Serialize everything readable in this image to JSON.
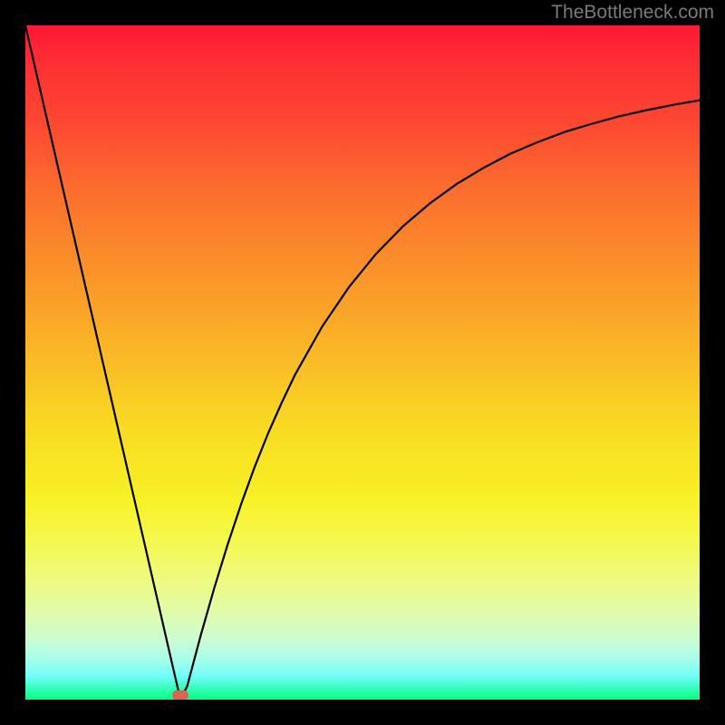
{
  "watermark": "TheBottleneck.com",
  "colors": {
    "curve_stroke": "#000000",
    "min_point": "#d9674f"
  },
  "chart_data": {
    "type": "line",
    "title": "",
    "xlabel": "",
    "ylabel": "",
    "xlim": [
      0,
      100
    ],
    "ylim": [
      0,
      100
    ],
    "x": [
      0,
      2,
      4,
      6,
      8,
      10,
      12,
      14,
      16,
      18,
      20,
      22,
      23,
      24,
      26,
      28,
      30,
      32,
      34,
      36,
      38,
      40,
      44,
      48,
      52,
      56,
      60,
      64,
      68,
      72,
      76,
      80,
      84,
      88,
      92,
      96,
      100
    ],
    "y": [
      100,
      91.3,
      82.6,
      73.9,
      65.2,
      56.5,
      47.8,
      39.1,
      30.4,
      21.7,
      13.0,
      4.3,
      0.0,
      2.0,
      9.5,
      16.5,
      23.0,
      29.0,
      34.5,
      39.5,
      44.0,
      48.2,
      55.3,
      61.2,
      66.1,
      70.2,
      73.6,
      76.5,
      78.9,
      81.0,
      82.7,
      84.2,
      85.4,
      86.5,
      87.4,
      88.2,
      88.9
    ],
    "min_point": {
      "x": 23,
      "y": 0
    }
  }
}
